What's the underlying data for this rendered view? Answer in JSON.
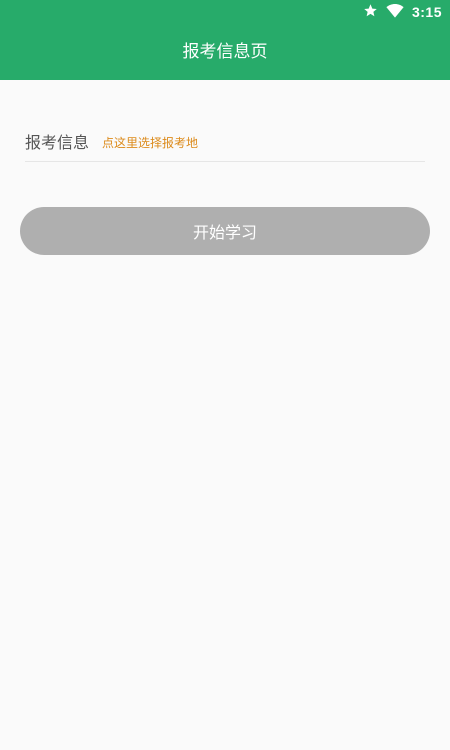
{
  "status_bar": {
    "time": "3:15",
    "icons": [
      "star-icon",
      "wifi-icon"
    ]
  },
  "header": {
    "title": "报考信息页",
    "background_color": "#27ab6a"
  },
  "form": {
    "label": "报考信息",
    "value_placeholder": "点这里选择报考地",
    "value_color": "#dc8b1c"
  },
  "actions": {
    "start_label": "开始学习",
    "start_button_color": "#afafaf"
  }
}
